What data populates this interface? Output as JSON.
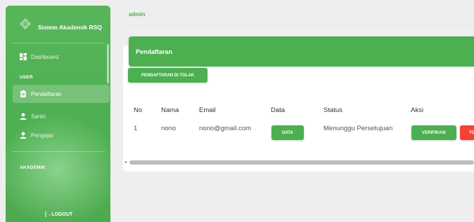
{
  "sidebar": {
    "brand": "Sistem Akademik RSQ",
    "dashboard_label": "Dashboard",
    "section_user": "USER",
    "items": [
      {
        "label": "Pendaftaran",
        "icon": "clipboard-icon",
        "active": true
      },
      {
        "label": "Santri",
        "icon": "person-icon"
      },
      {
        "label": "Pengajar",
        "icon": "person-icon"
      }
    ],
    "section_akademik": "AKADEMIK",
    "logout_label": "[→LOGOUT"
  },
  "topbar": {
    "user": "admin"
  },
  "card": {
    "title": "Pendaftaran",
    "rejected_button": "PENDAFTARAN DI TOLAK",
    "columns": [
      "No",
      "Nama",
      "Email",
      "Data",
      "Status",
      "Aksi"
    ],
    "rows": [
      {
        "no": "1",
        "nama": "nono",
        "email": "nono@gmail.com",
        "data_button": "DATA",
        "status": "Menunggu Persetujuan",
        "verify_button": "VERIFIKASI",
        "reject_button": "TOLAK"
      }
    ]
  },
  "colors": {
    "primary": "#4caf50",
    "danger": "#f44336",
    "background": "#eeeeee"
  }
}
